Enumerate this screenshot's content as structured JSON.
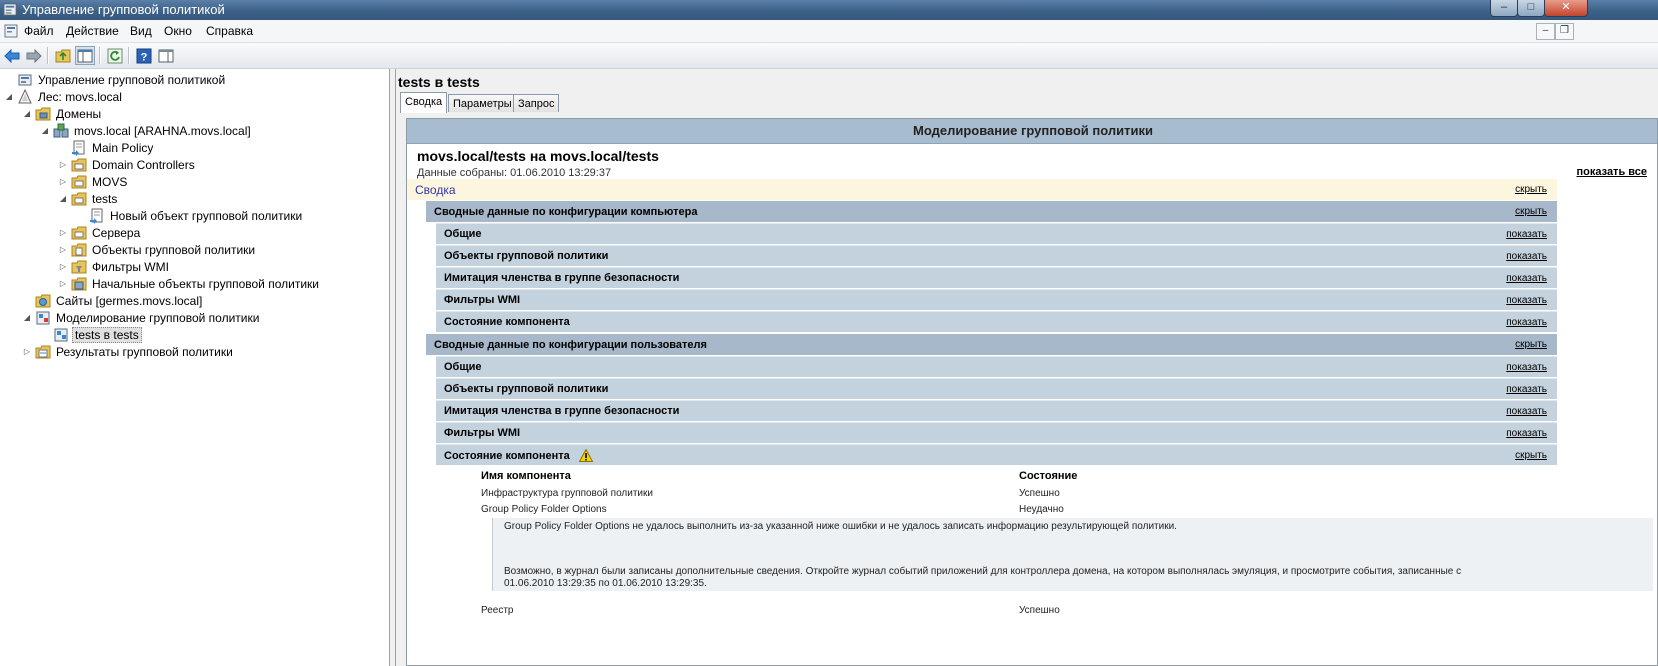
{
  "window": {
    "title": "Управление групповой политикой",
    "buttons": {
      "minimize": "–",
      "maximize": "□",
      "close": "✕"
    }
  },
  "menu": {
    "items": [
      {
        "label": "Файл"
      },
      {
        "label": "Действие"
      },
      {
        "label": "Вид"
      },
      {
        "label": "Окно"
      },
      {
        "label": "Справка"
      }
    ],
    "mdi_buttons": {
      "minimize": "–",
      "restore": "❐"
    }
  },
  "toolbar": {
    "icons": [
      "back-arrow-icon",
      "forward-arrow-icon",
      "up-folder-icon",
      "show-hide-tree-icon",
      "refresh-icon",
      "help-icon",
      "action-pane-icon"
    ]
  },
  "tree": {
    "items": [
      {
        "label": "Управление групповой политикой",
        "level": 0,
        "expander": "",
        "icon": "gpm-root-icon"
      },
      {
        "label": "Лес: movs.local",
        "level": 1,
        "expander": "◢",
        "icon": "forest-icon"
      },
      {
        "label": "Домены",
        "level": 2,
        "expander": "◢",
        "icon": "domains-folder-icon"
      },
      {
        "label": "movs.local [ARAHNA.movs.local]",
        "level": 3,
        "expander": "◢",
        "icon": "domain-icon"
      },
      {
        "label": "Main Policy",
        "level": 4,
        "expander": "",
        "icon": "gpo-link-icon"
      },
      {
        "label": "Domain Controllers",
        "level": 4,
        "expander": "▷",
        "icon": "ou-icon"
      },
      {
        "label": "MOVS",
        "level": 4,
        "expander": "▷",
        "icon": "ou-icon"
      },
      {
        "label": "tests",
        "level": 4,
        "expander": "◢",
        "icon": "ou-icon"
      },
      {
        "label": "Новый объект групповой политики",
        "level": 5,
        "expander": "",
        "icon": "gpo-link-icon"
      },
      {
        "label": "Сервера",
        "level": 4,
        "expander": "▷",
        "icon": "ou-icon"
      },
      {
        "label": "Объекты групповой политики",
        "level": 4,
        "expander": "▷",
        "icon": "gpo-folder-icon"
      },
      {
        "label": "Фильтры WMI",
        "level": 4,
        "expander": "▷",
        "icon": "wmi-folder-icon"
      },
      {
        "label": "Начальные объекты групповой политики",
        "level": 4,
        "expander": "▷",
        "icon": "starter-gpo-icon"
      },
      {
        "label": "Сайты [germes.movs.local]",
        "level": 2,
        "expander": "",
        "icon": "sites-icon"
      },
      {
        "label": "Моделирование групповой политики",
        "level": 2,
        "expander": "◢",
        "icon": "modeling-icon"
      },
      {
        "label": "tests в tests",
        "level": 3,
        "expander": "",
        "icon": "modeling-result-icon",
        "selected": true
      },
      {
        "label": "Результаты групповой политики",
        "level": 2,
        "expander": "▷",
        "icon": "results-icon"
      }
    ]
  },
  "right": {
    "title": "tests в tests",
    "tabs": [
      {
        "label": "Сводка",
        "active": true
      },
      {
        "label": "Параметры",
        "active": false
      },
      {
        "label": "Запрос",
        "active": false
      }
    ]
  },
  "report": {
    "header": "Моделирование групповой политики",
    "title": "movs.local/tests на movs.local/tests",
    "collected": "Данные собраны: 01.06.2010 13:29:37",
    "show_all": "показать все",
    "summary": {
      "label": "Сводка",
      "link": "скрыть"
    },
    "computer": {
      "label": "Сводные данные по конфигурации компьютера",
      "link": "скрыть",
      "items": [
        {
          "label": "Общие",
          "link": "показать"
        },
        {
          "label": "Объекты групповой политики",
          "link": "показать"
        },
        {
          "label": "Имитация членства в группе безопасности",
          "link": "показать"
        },
        {
          "label": "Фильтры WMI",
          "link": "показать"
        },
        {
          "label": "Состояние компонента",
          "link": "показать"
        }
      ]
    },
    "user": {
      "label": "Сводные данные по конфигурации пользователя",
      "link": "скрыть",
      "items": [
        {
          "label": "Общие",
          "link": "показать"
        },
        {
          "label": "Объекты групповой политики",
          "link": "показать"
        },
        {
          "label": "Имитация членства в группе безопасности",
          "link": "показать"
        },
        {
          "label": "Фильтры WMI",
          "link": "показать"
        },
        {
          "label": "Состояние компонента",
          "link": "скрыть",
          "warning": true
        }
      ]
    },
    "components": {
      "headers": {
        "name": "Имя компонента",
        "state": "Состояние"
      },
      "rows": [
        {
          "name": "Инфраструктура групповой политики",
          "state": "Успешно"
        },
        {
          "name": "Group Policy Folder Options",
          "state": "Неудачно"
        },
        {
          "name": "Реестр",
          "state": "Успешно"
        }
      ],
      "detail": {
        "line1": "Group Policy Folder Options не удалось выполнить из-за указанной ниже ошибки и не удалось записать информацию результирующей политики.",
        "line2": "Возможно, в журнал были записаны дополнительные сведения. Откройте журнал событий приложений для контроллера домена, на котором выполнялась эмуляция, и просмотрите события, записанные с",
        "line3": "01.06.2010 13:29:35 по 01.06.2010 13:29:35."
      }
    }
  }
}
